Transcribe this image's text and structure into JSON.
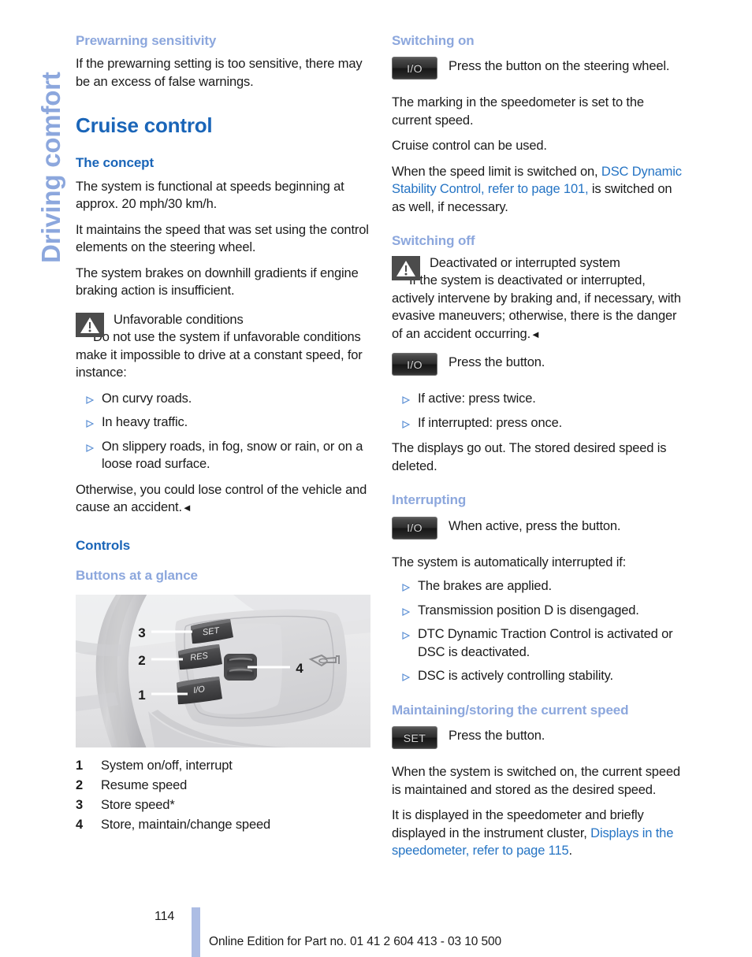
{
  "chapter": {
    "tab_label": "Driving comfort"
  },
  "left_column": {
    "prewarning": {
      "heading": "Prewarning sensitivity",
      "paragraph": "If the prewarning setting is too sensitive, there may be an excess of false warnings."
    },
    "title": "Cruise control",
    "concept": {
      "heading": "The concept",
      "p1": "The system is functional at speeds beginning at approx. 20 mph/30 km/h.",
      "p2": "It maintains the speed that was set using the control elements on the steering wheel.",
      "p3": "The system brakes on downhill gradients if engine braking action is insufficient."
    },
    "warning": {
      "icon": "warning-triangle-icon",
      "heading": "Unfavorable conditions",
      "body": "Do not use the system if unfavorable conditions make it impossible to drive at a constant speed, for instance:",
      "bullets": [
        "On curvy roads.",
        "In heavy traffic.",
        "On slippery roads, in fog, snow or rain, or on a loose road surface."
      ],
      "closing": "Otherwise, you could lose control of the vehicle and cause an accident.",
      "end_mark": "◄"
    },
    "controls": {
      "heading": "Controls",
      "subheading": "Buttons at a glance",
      "figure_name": "steering-wheel-cruise-control-buttons",
      "figure_callouts": [
        "1",
        "2",
        "3",
        "4"
      ],
      "figure_button_labels": [
        "SET",
        "RES",
        "I/O"
      ],
      "legend": [
        {
          "num": "1",
          "text": "System on/off, interrupt"
        },
        {
          "num": "2",
          "text": "Resume speed"
        },
        {
          "num": "3",
          "text": "Store speed*"
        },
        {
          "num": "4",
          "text": "Store, maintain/change speed"
        }
      ]
    }
  },
  "right_column": {
    "switching_on": {
      "heading": "Switching on",
      "button_label": "I/O",
      "button_text": "Press the button on the steering wheel.",
      "p1": "The marking in the speedometer is set to the current speed.",
      "p2": "Cruise control can be used.",
      "p3_before": "When the speed limit is switched on, ",
      "p3_link": "DSC Dynamic Stability Control, refer to page 101,",
      "p3_after": " is switched on as well, if necessary."
    },
    "switching_off": {
      "heading": "Switching off",
      "warning_heading": "Deactivated or interrupted system",
      "warning_body": "If the system is deactivated or interrupted, actively intervene by braking and, if necessary, with evasive maneuvers; otherwise, there is the danger of an accident occurring.",
      "end_mark": "◄",
      "button_label": "I/O",
      "button_text": "Press the button.",
      "bullets": [
        "If active: press twice.",
        "If interrupted: press once."
      ],
      "closing": "The displays go out. The stored desired speed is deleted."
    },
    "interrupting": {
      "heading": "Interrupting",
      "button_label": "I/O",
      "button_text": "When active, press the button.",
      "intro": "The system is automatically interrupted if:",
      "bullets": [
        "The brakes are applied.",
        "Transmission position D is disengaged.",
        "DTC Dynamic Traction Control is activated or DSC is deactivated.",
        "DSC is actively controlling stability."
      ]
    },
    "maintaining": {
      "heading": "Maintaining/storing the current speed",
      "button_label": "SET",
      "button_text": "Press the button.",
      "p1": "When the system is switched on, the current speed is maintained and stored as the desired speed.",
      "p2_before": "It is displayed in the speedometer and briefly displayed in the instrument cluster, ",
      "p2_link": "Displays in the speedometer, refer to page 115",
      "p2_after": "."
    }
  },
  "footer": {
    "page_number": "114",
    "text": "Online Edition for Part no. 01 41 2 604 413 - 03 10 500"
  },
  "colors": {
    "heading_dark_blue": "#1a65b8",
    "heading_light_blue": "#8ca7dd",
    "link_blue": "#2574c4",
    "body_text": "#1b1b1b",
    "footer_bar": "#adbde4"
  }
}
